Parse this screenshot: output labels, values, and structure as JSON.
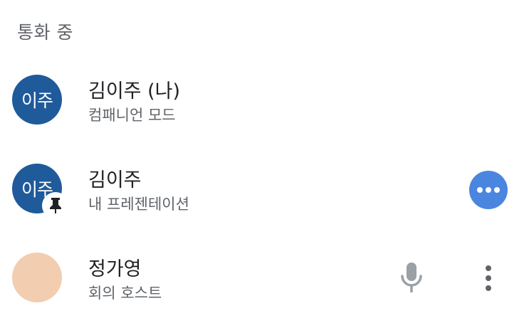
{
  "section": {
    "header": "통화 중"
  },
  "participants": [
    {
      "avatar_initials": "이주",
      "name": "김이주 (나)",
      "subtitle": "컴패니언 모드",
      "avatar_color": "#1f5a9b"
    },
    {
      "avatar_initials": "이주",
      "name": "김이주",
      "subtitle": "내 프레젠테이션",
      "avatar_color": "#1f5a9b",
      "badge_icon": "pin-icon",
      "action_icon": "more-horizontal-icon",
      "action_color": "#4a86e0"
    },
    {
      "avatar_initials": "",
      "name": "정가영",
      "subtitle": "회의 호스트",
      "avatar_color": "#f2cdb0",
      "status_icon": "microphone-icon",
      "action_icon": "more-vertical-icon"
    }
  ]
}
